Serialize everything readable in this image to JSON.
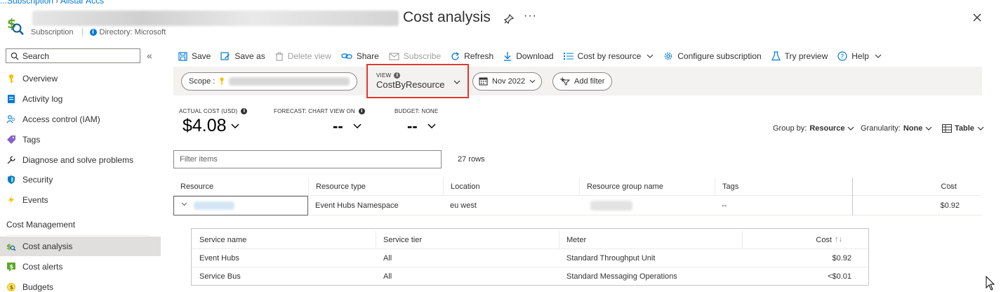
{
  "breadcrumb": {
    "item1": "...Subscription",
    "item2": "Allstar Accs"
  },
  "header": {
    "title": "Cost analysis",
    "subscription_label": "Subscription",
    "directory_label": "Directory: Microsoft"
  },
  "sidebar": {
    "search_placeholder": "Search",
    "items": [
      {
        "label": "Overview",
        "icon": "key-icon"
      },
      {
        "label": "Activity log",
        "icon": "log-icon"
      },
      {
        "label": "Access control (IAM)",
        "icon": "people-icon"
      },
      {
        "label": "Tags",
        "icon": "tag-icon"
      },
      {
        "label": "Diagnose and solve problems",
        "icon": "wrench-icon"
      },
      {
        "label": "Security",
        "icon": "shield-icon"
      },
      {
        "label": "Events",
        "icon": "lightning-icon"
      }
    ],
    "section_heading": "Cost Management",
    "cost_items": [
      {
        "label": "Cost analysis",
        "icon": "cost-analysis-icon"
      },
      {
        "label": "Cost alerts",
        "icon": "alert-icon"
      },
      {
        "label": "Budgets",
        "icon": "budget-icon"
      }
    ]
  },
  "toolbar": {
    "save": "Save",
    "save_as": "Save as",
    "delete_view": "Delete view",
    "share": "Share",
    "subscribe": "Subscribe",
    "refresh": "Refresh",
    "download": "Download",
    "cost_by_resource": "Cost by resource",
    "configure": "Configure subscription",
    "try_preview": "Try preview",
    "help": "Help"
  },
  "filters": {
    "scope_label": "Scope :",
    "view_label": "VIEW",
    "view_value": "CostByResource",
    "date_range": "Nov 2022",
    "add_filter": "Add filter"
  },
  "kpis": {
    "actual_label": "ACTUAL COST (USD)",
    "actual_value": "$4.08",
    "forecast_label": "FORECAST: CHART VIEW ON",
    "forecast_value": "--",
    "budget_label": "BUDGET: NONE",
    "budget_value": "--"
  },
  "controls": {
    "group_by_label": "Group by:",
    "group_by_value": "Resource",
    "granularity_label": "Granularity:",
    "granularity_value": "None",
    "view_type": "Table"
  },
  "table": {
    "filter_placeholder": "Filter items",
    "row_count": "27 rows",
    "columns": [
      "Resource",
      "Resource type",
      "Location",
      "Resource group name",
      "Tags",
      "Cost"
    ],
    "row": {
      "resource_type": "Event Hubs Namespace",
      "location": "eu west",
      "tags": "--",
      "cost": "$0.92"
    }
  },
  "subtable": {
    "columns": [
      "Service name",
      "Service tier",
      "Meter",
      "Cost"
    ],
    "rows": [
      {
        "service": "Event Hubs",
        "tier": "All",
        "meter": "Standard Throughput Unit",
        "cost": "$0.92"
      },
      {
        "service": "Service Bus",
        "tier": "All",
        "meter": "Standard Messaging Operations",
        "cost": "<$0.01"
      }
    ]
  },
  "colors": {
    "accent": "#0078d4",
    "highlight": "#e3362c",
    "active_bg": "#e1dfdd"
  }
}
